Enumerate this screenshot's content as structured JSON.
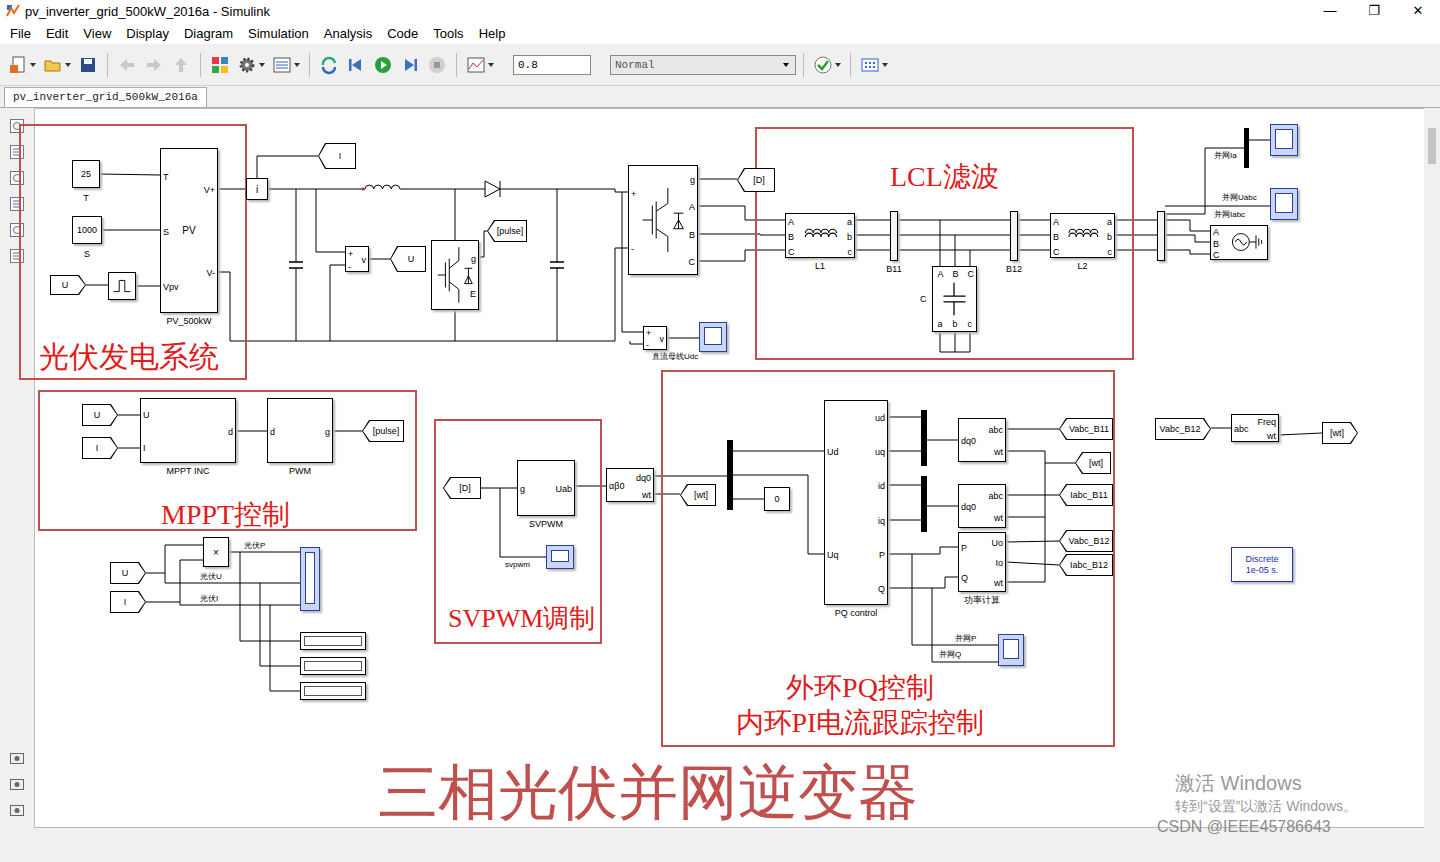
{
  "window": {
    "title": "pv_inverter_grid_500kW_2016a - Simulink",
    "controls": [
      "—",
      "❐",
      "✕"
    ]
  },
  "menu": [
    "File",
    "Edit",
    "View",
    "Display",
    "Diagram",
    "Simulation",
    "Analysis",
    "Code",
    "Tools",
    "Help"
  ],
  "toolbar": {
    "stop_time": "0.8",
    "mode": "Normal"
  },
  "tabs": [
    {
      "label": "pv_inverter_grid_500kW_2016a",
      "selected": true
    }
  ],
  "annotations": [
    {
      "lines": [
        "光伏发电系统"
      ]
    },
    {
      "lines": [
        "LCL滤波"
      ]
    },
    {
      "lines": [
        "MPPT控制"
      ]
    },
    {
      "lines": [
        "SVPWM调制"
      ]
    },
    {
      "lines": [
        "外环PQ控制",
        "内环PI电流跟踪控制"
      ]
    }
  ],
  "caption": "三相光伏并网逆变器",
  "blocks": [
    {
      "kind": "pv",
      "center": "PV",
      "caption": "PV_500kW",
      "left": [
        "T",
        "S",
        "Vpv"
      ],
      "right": [
        "V+",
        "V-"
      ]
    },
    {
      "kind": "relay"
    },
    {
      "kind": "meter",
      "center": "i"
    },
    {
      "kind": "meter",
      "left": [
        "+",
        "-"
      ],
      "right": [
        "v"
      ]
    },
    {
      "kind": "igbt",
      "right": [
        "g",
        "E"
      ]
    },
    {
      "kind": "inverter",
      "left": [
        "+",
        "-"
      ],
      "right": [
        "g",
        "A",
        "B",
        "C"
      ]
    },
    {
      "kind": "meter",
      "left": [
        "+",
        "-"
      ],
      "right": [
        "v"
      ]
    },
    {
      "kind": "inductor",
      "caption": "L1",
      "left": [
        "A",
        "B",
        "C"
      ],
      "right": [
        "a",
        "b",
        "c"
      ]
    },
    {
      "kind": "bus",
      "caption": "B11"
    },
    {
      "kind": "bus",
      "caption": "B12"
    },
    {
      "kind": "capacitor",
      "caption": "C",
      "top": [
        "A",
        "B",
        "C"
      ],
      "bottom": [
        "a",
        "b",
        "c"
      ]
    },
    {
      "kind": "inductor",
      "caption": "L2",
      "left": [
        "A",
        "B",
        "C"
      ],
      "right": [
        "a",
        "b",
        "c"
      ]
    },
    {
      "kind": "bus"
    },
    {
      "kind": "source",
      "left": [
        "A",
        "B",
        "C"
      ]
    },
    {
      "kind": "plain",
      "caption": "MPPT INC",
      "left": [
        "U",
        "I"
      ],
      "right": [
        "d"
      ]
    },
    {
      "kind": "plain",
      "caption": "PWM",
      "left": [
        "d"
      ],
      "right": [
        "g"
      ]
    },
    {
      "kind": "plain",
      "center": "×"
    },
    {
      "kind": "plain",
      "caption": "SVPWM",
      "left": [
        "g"
      ],
      "right": [
        "Uab"
      ]
    },
    {
      "kind": "transform",
      "left": [
        "αβ0"
      ],
      "right": [
        "dq0",
        "wt"
      ]
    },
    {
      "kind": "plain",
      "caption": "PQ control",
      "left": [
        "Ud",
        "Uq"
      ],
      "right": [
        "ud",
        "uq",
        "id",
        "iq",
        "P",
        "Q"
      ]
    },
    {
      "kind": "transform",
      "left": [
        "dq0"
      ],
      "right": [
        "abc",
        "wt"
      ]
    },
    {
      "kind": "transform",
      "left": [
        "dq0"
      ],
      "right": [
        "abc",
        "wt"
      ]
    },
    {
      "kind": "plain",
      "caption": "功率计算",
      "left": [
        "P",
        "Q"
      ],
      "right": [
        "Uo",
        "Io",
        "wt"
      ]
    },
    {
      "kind": "plain",
      "left": [
        "abc"
      ],
      "right": [
        "Freq",
        "wt"
      ]
    }
  ],
  "tags": [
    {
      "text": "I",
      "kind": "leftward"
    },
    {
      "text": "U",
      "kind": "leftward"
    },
    {
      "text": "U",
      "kind": "rightward"
    },
    {
      "text": "[pulse]",
      "kind": "leftward"
    },
    {
      "text": "[D]",
      "kind": "leftward"
    },
    {
      "text": "U",
      "kind": "rightward"
    },
    {
      "text": "I",
      "kind": "rightward"
    },
    {
      "text": "[pulse]",
      "kind": "leftward"
    },
    {
      "text": "U",
      "kind": "rightward"
    },
    {
      "text": "I",
      "kind": "rightward"
    },
    {
      "text": "[D]",
      "kind": "leftward"
    },
    {
      "text": "[wt]",
      "kind": "leftward"
    },
    {
      "text": "Vabc_B11",
      "kind": "leftward"
    },
    {
      "text": "[wt]",
      "kind": "leftward"
    },
    {
      "text": "Iabc_B11",
      "kind": "leftward"
    },
    {
      "text": "Vabc_B12",
      "kind": "leftward"
    },
    {
      "text": "Iabc_B12",
      "kind": "leftward"
    },
    {
      "text": "Vabc_B12",
      "kind": "rightward"
    },
    {
      "text": "[wt]",
      "kind": "rightward"
    }
  ],
  "constants": [
    {
      "value": "25",
      "caption": "T"
    },
    {
      "value": "1000",
      "caption": "S"
    },
    {
      "value": "0"
    }
  ],
  "signal_labels": [
    {
      "text": "直流母线Udc"
    },
    {
      "text": "并网Ia"
    },
    {
      "text": "并网Uabc"
    },
    {
      "text": "并网Iabc"
    },
    {
      "text": "光伏P"
    },
    {
      "text": "光伏U"
    },
    {
      "text": "光伏I"
    },
    {
      "text": "svpwm"
    },
    {
      "text": "并网P"
    },
    {
      "text": "并网Q"
    }
  ],
  "displays": [
    {
      "value": ""
    },
    {
      "value": ""
    },
    {
      "value": ""
    }
  ],
  "powergui": {
    "lines": [
      "Discrete",
      "1e-05 s."
    ]
  },
  "watermark": {
    "lines": [
      "激活 Windows",
      "转到“设置”以激活 Windows。",
      "CSDN @IEEE45786643"
    ]
  }
}
